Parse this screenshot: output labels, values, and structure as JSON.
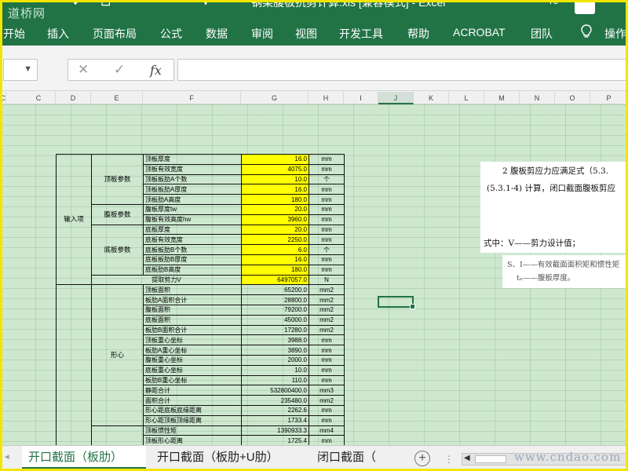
{
  "title_bar": {
    "watermark": "道桥网",
    "title": "钢梁腹板抗剪计算.xls  [兼容模式]  -  Excel",
    "user": "rc"
  },
  "ribbon": {
    "tabs": [
      "开始",
      "插入",
      "页面布局",
      "公式",
      "数据",
      "审阅",
      "视图",
      "开发工具",
      "帮助",
      "ACROBAT",
      "团队",
      "操作"
    ]
  },
  "formula_bar": {
    "cancel": "✕",
    "confirm": "✓",
    "fx": "fx",
    "value": ""
  },
  "columns": [
    "C",
    "C",
    "D",
    "E",
    "F",
    "G",
    "H",
    "I",
    "J",
    "K",
    "L",
    "M",
    "N",
    "O",
    "P"
  ],
  "selected_column": "J",
  "table": {
    "input_group": "输入项",
    "groups": {
      "top": "顶板参数",
      "web": "腹板参数",
      "bottom": "底板参数",
      "centroid": "形心"
    },
    "top_rows": [
      {
        "item": "顶板厚度",
        "value": "16.0",
        "unit": "mm"
      },
      {
        "item": "顶板有效宽度",
        "value": "4075.0",
        "unit": "mm"
      },
      {
        "item": "顶板板肋A个数",
        "value": "10.0",
        "unit": "个"
      },
      {
        "item": "顶板板肋A厚度",
        "value": "16.0",
        "unit": "mm"
      },
      {
        "item": "顶板肋A高度",
        "value": "180.0",
        "unit": "mm"
      }
    ],
    "web_rows": [
      {
        "item": "腹板厚度tw",
        "value": "20.0",
        "unit": "mm"
      },
      {
        "item": "腹板有效高度hw",
        "value": "3960.0",
        "unit": "mm"
      }
    ],
    "bottom_rows": [
      {
        "item": "底板厚度",
        "value": "20.0",
        "unit": "mm"
      },
      {
        "item": "底板有效宽度",
        "value": "2250.0",
        "unit": "mm"
      },
      {
        "item": "底板板肋B个数",
        "value": "6.0",
        "unit": "个"
      },
      {
        "item": "底板板肋B厚度",
        "value": "16.0",
        "unit": "mm"
      },
      {
        "item": "底板肋B高度",
        "value": "180.0",
        "unit": "mm"
      }
    ],
    "shear_row": {
      "item": "提取剪力V",
      "value": "6497057.0",
      "unit": "N"
    },
    "centroid_rows": [
      {
        "item": "顶板面积",
        "value": "65200.0",
        "unit": "mm2"
      },
      {
        "item": "板肋A面积合计",
        "value": "28800.0",
        "unit": "mm2"
      },
      {
        "item": "腹板面积",
        "value": "79200.0",
        "unit": "mm2"
      },
      {
        "item": "底板面积",
        "value": "45000.0",
        "unit": "mm2"
      },
      {
        "item": "板肋B面积合计",
        "value": "17280.0",
        "unit": "mm2"
      },
      {
        "item": "顶板重心坐标",
        "value": "3988.0",
        "unit": "mm"
      },
      {
        "item": "板肋A重心坐标",
        "value": "3890.0",
        "unit": "mm"
      },
      {
        "item": "腹板重心坐标",
        "value": "2000.0",
        "unit": "mm"
      },
      {
        "item": "底板重心坐标",
        "value": "10.0",
        "unit": "mm"
      },
      {
        "item": "板肋B重心坐标",
        "value": "110.0",
        "unit": "mm"
      },
      {
        "item": "静距合计",
        "value": "532800400.0",
        "unit": "mm3"
      },
      {
        "item": "面积合计",
        "value": "235480.0",
        "unit": "mm2"
      },
      {
        "item": "形心距底板底缘距离",
        "value": "2262.6",
        "unit": "mm"
      },
      {
        "item": "形心距顶板顶缘距离",
        "value": "1733.4",
        "unit": "mm"
      }
    ],
    "extra_rows": [
      {
        "item": "顶板惯性矩",
        "value": "1390933.3",
        "unit": "mm4"
      },
      {
        "item": "顶板形心距离",
        "value": "1725.4",
        "unit": "mm"
      }
    ]
  },
  "spec": {
    "line1": "2  腹板剪应力应满足式（5.3.",
    "line2": "(5.3.1-4) 计算，闭口截面腹板剪应",
    "line3": "式中：V——剪力设计值；",
    "line4": "S、I——有效截面面积矩和惯性矩",
    "line5": "tₙ——腹板厚度。"
  },
  "sheet_tabs": [
    "开口截面（板肋）",
    "开口截面（板肋+U肋）",
    "闭口截面（"
  ],
  "active_sheet": "开口截面（板肋）",
  "site_watermark": "www.cndao.com"
}
